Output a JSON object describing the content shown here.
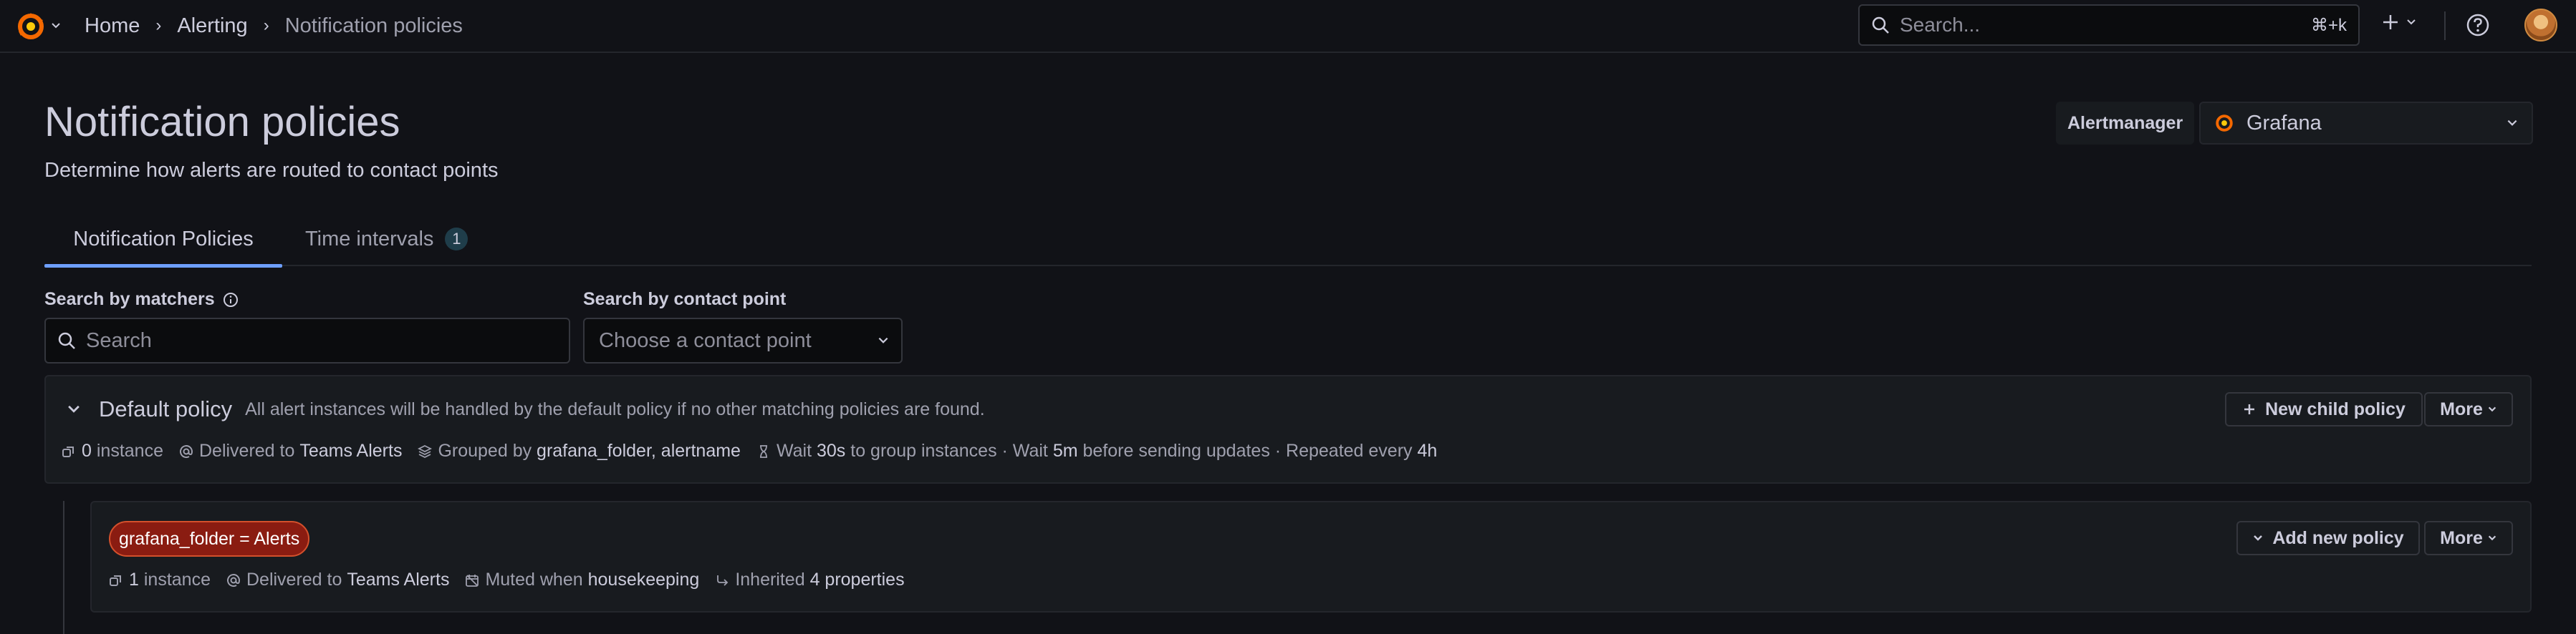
{
  "topbar": {
    "breadcrumbs": [
      "Home",
      "Alerting",
      "Notification policies"
    ],
    "search_placeholder": "Search...",
    "search_shortcut": "⌘+k"
  },
  "header": {
    "title": "Notification policies",
    "subtitle": "Determine how alerts are routed to contact points",
    "alertmanager_label": "Alertmanager",
    "alertmanager_value": "Grafana"
  },
  "tabs": [
    {
      "label": "Notification Policies",
      "active": true
    },
    {
      "label": "Time intervals",
      "count": "1",
      "active": false
    }
  ],
  "filters": {
    "matchers_label": "Search by matchers",
    "matchers_placeholder": "Search",
    "contact_label": "Search by contact point",
    "contact_placeholder": "Choose a contact point"
  },
  "default_policy": {
    "name": "Default policy",
    "description": "All alert instances will be handled by the default policy if no other matching policies are found.",
    "instances_count": "0",
    "instances_word": "instance",
    "delivered_prefix": "Delivered to",
    "contact_point": "Teams Alerts",
    "grouped_prefix": "Grouped by",
    "grouped_by": "grafana_folder, alertname",
    "wait_prefix": "Wait",
    "group_wait": "30s",
    "wait_mid": "to group instances · Wait",
    "group_interval": "5m",
    "wait_suffix": "before sending updates · Repeated every",
    "repeat_interval": "4h",
    "new_child_label": "New child policy",
    "more_label": "More"
  },
  "child_policy": {
    "matcher": "grafana_folder = Alerts",
    "instances_count": "1",
    "instances_word": "instance",
    "delivered_prefix": "Delivered to",
    "contact_point": "Teams Alerts",
    "muted_prefix": "Muted when",
    "muted_when": "housekeeping",
    "inherited_prefix": "Inherited",
    "inherited_count": "4 properties",
    "add_policy_label": "Add new policy",
    "more_label": "More"
  }
}
